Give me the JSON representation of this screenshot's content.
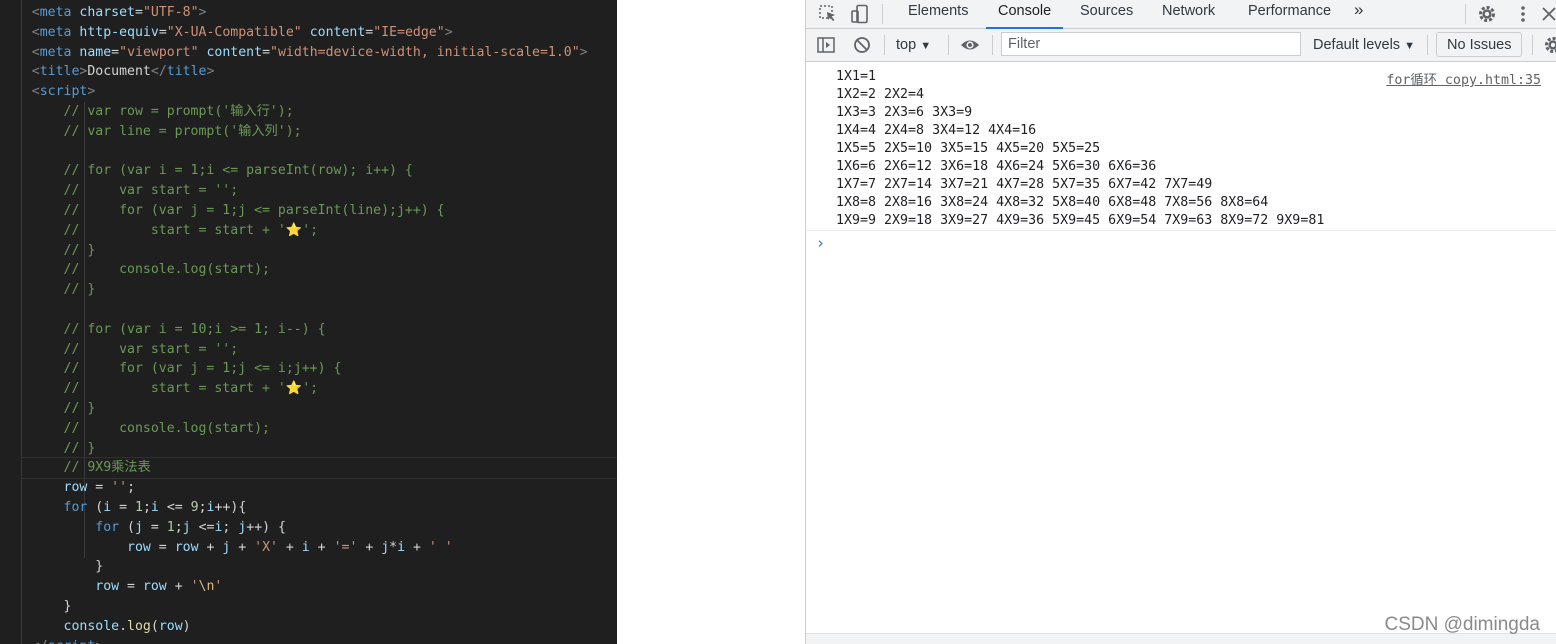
{
  "editor": {
    "lines": [
      [
        {
          "c": "tk-punc",
          "t": "    <"
        },
        {
          "c": "tk-tag",
          "t": "meta "
        },
        {
          "c": "tk-attr",
          "t": "charset"
        },
        {
          "c": "tk-text",
          "t": "="
        },
        {
          "c": "tk-str",
          "t": "\"UTF-8\""
        },
        {
          "c": "tk-punc",
          "t": ">"
        }
      ],
      [
        {
          "c": "tk-punc",
          "t": "    <"
        },
        {
          "c": "tk-tag",
          "t": "meta "
        },
        {
          "c": "tk-attr",
          "t": "http-equiv"
        },
        {
          "c": "tk-text",
          "t": "="
        },
        {
          "c": "tk-str",
          "t": "\"X-UA-Compatible\""
        },
        {
          "c": "tk-text",
          "t": " "
        },
        {
          "c": "tk-attr",
          "t": "content"
        },
        {
          "c": "tk-text",
          "t": "="
        },
        {
          "c": "tk-str",
          "t": "\"IE=edge\""
        },
        {
          "c": "tk-punc",
          "t": ">"
        }
      ],
      [
        {
          "c": "tk-punc",
          "t": "    <"
        },
        {
          "c": "tk-tag",
          "t": "meta "
        },
        {
          "c": "tk-attr",
          "t": "name"
        },
        {
          "c": "tk-text",
          "t": "="
        },
        {
          "c": "tk-str",
          "t": "\"viewport\""
        },
        {
          "c": "tk-text",
          "t": " "
        },
        {
          "c": "tk-attr",
          "t": "content"
        },
        {
          "c": "tk-text",
          "t": "="
        },
        {
          "c": "tk-str",
          "t": "\"width=device-width, initial-scale=1.0\""
        },
        {
          "c": "tk-punc",
          "t": ">"
        }
      ],
      [
        {
          "c": "tk-punc",
          "t": "    <"
        },
        {
          "c": "tk-tag",
          "t": "title"
        },
        {
          "c": "tk-punc",
          "t": ">"
        },
        {
          "c": "tk-text",
          "t": "Document"
        },
        {
          "c": "tk-punc",
          "t": "</"
        },
        {
          "c": "tk-tag",
          "t": "title"
        },
        {
          "c": "tk-punc",
          "t": ">"
        }
      ],
      [
        {
          "c": "tk-punc",
          "t": "    <"
        },
        {
          "c": "tk-tag",
          "t": "script"
        },
        {
          "c": "tk-punc",
          "t": ">"
        }
      ],
      [
        {
          "c": "tk-com",
          "t": "        // var row = prompt('输入行');"
        }
      ],
      [
        {
          "c": "tk-com",
          "t": "        // var line = prompt('输入列');"
        }
      ],
      [
        {
          "c": "tk-text",
          "t": ""
        }
      ],
      [
        {
          "c": "tk-com",
          "t": "        // for (var i = 1;i <= parseInt(row); i++) {"
        }
      ],
      [
        {
          "c": "tk-com",
          "t": "        //     var start = '';"
        }
      ],
      [
        {
          "c": "tk-com",
          "t": "        //     for (var j = 1;j <= parseInt(line);j++) {"
        }
      ],
      [
        {
          "c": "tk-com",
          "t": "        //         start = start + '⭐';"
        }
      ],
      [
        {
          "c": "tk-com",
          "t": "        // }"
        }
      ],
      [
        {
          "c": "tk-com",
          "t": "        //     console.log(start);"
        }
      ],
      [
        {
          "c": "tk-com",
          "t": "        // }"
        }
      ],
      [
        {
          "c": "tk-text",
          "t": ""
        }
      ],
      [
        {
          "c": "tk-com",
          "t": "        // for (var i = 10;i >= 1; i--) {"
        }
      ],
      [
        {
          "c": "tk-com",
          "t": "        //     var start = '';"
        }
      ],
      [
        {
          "c": "tk-com",
          "t": "        //     for (var j = 1;j <= i;j++) {"
        }
      ],
      [
        {
          "c": "tk-com",
          "t": "        //         start = start + '⭐';"
        }
      ],
      [
        {
          "c": "tk-com",
          "t": "        // }"
        }
      ],
      [
        {
          "c": "tk-com",
          "t": "        //     console.log(start);"
        }
      ],
      [
        {
          "c": "tk-com",
          "t": "        // }"
        }
      ],
      [
        {
          "c": "tk-com",
          "t": "        // 9X9乘法表"
        }
      ],
      [
        {
          "c": "tk-var",
          "t": "        row"
        },
        {
          "c": "tk-op",
          "t": " = "
        },
        {
          "c": "tk-str",
          "t": "''"
        },
        {
          "c": "tk-op",
          "t": ";"
        }
      ],
      [
        {
          "c": "tk-kw",
          "t": "        for"
        },
        {
          "c": "tk-op",
          "t": " ("
        },
        {
          "c": "tk-var",
          "t": "i"
        },
        {
          "c": "tk-op",
          "t": " = "
        },
        {
          "c": "tk-num",
          "t": "1"
        },
        {
          "c": "tk-op",
          "t": ";"
        },
        {
          "c": "tk-var",
          "t": "i"
        },
        {
          "c": "tk-op",
          "t": " <= "
        },
        {
          "c": "tk-num",
          "t": "9"
        },
        {
          "c": "tk-op",
          "t": ";"
        },
        {
          "c": "tk-var",
          "t": "i"
        },
        {
          "c": "tk-op",
          "t": "++){"
        }
      ],
      [
        {
          "c": "tk-kw",
          "t": "            for"
        },
        {
          "c": "tk-op",
          "t": " ("
        },
        {
          "c": "tk-var",
          "t": "j"
        },
        {
          "c": "tk-op",
          "t": " = "
        },
        {
          "c": "tk-num",
          "t": "1"
        },
        {
          "c": "tk-op",
          "t": ";"
        },
        {
          "c": "tk-var",
          "t": "j"
        },
        {
          "c": "tk-op",
          "t": " <="
        },
        {
          "c": "tk-var",
          "t": "i"
        },
        {
          "c": "tk-op",
          "t": "; "
        },
        {
          "c": "tk-var",
          "t": "j"
        },
        {
          "c": "tk-op",
          "t": "++) {"
        }
      ],
      [
        {
          "c": "tk-var",
          "t": "                row"
        },
        {
          "c": "tk-op",
          "t": " = "
        },
        {
          "c": "tk-var",
          "t": "row"
        },
        {
          "c": "tk-op",
          "t": " + "
        },
        {
          "c": "tk-var",
          "t": "j"
        },
        {
          "c": "tk-op",
          "t": " + "
        },
        {
          "c": "tk-str",
          "t": "'X'"
        },
        {
          "c": "tk-op",
          "t": " + "
        },
        {
          "c": "tk-var",
          "t": "i"
        },
        {
          "c": "tk-op",
          "t": " + "
        },
        {
          "c": "tk-str",
          "t": "'='"
        },
        {
          "c": "tk-op",
          "t": " + "
        },
        {
          "c": "tk-var",
          "t": "j"
        },
        {
          "c": "tk-op",
          "t": "*"
        },
        {
          "c": "tk-var",
          "t": "i"
        },
        {
          "c": "tk-op",
          "t": " + "
        },
        {
          "c": "tk-str",
          "t": "' '"
        }
      ],
      [
        {
          "c": "tk-op",
          "t": "            }"
        }
      ],
      [
        {
          "c": "tk-var",
          "t": "            row"
        },
        {
          "c": "tk-op",
          "t": " = "
        },
        {
          "c": "tk-var",
          "t": "row"
        },
        {
          "c": "tk-op",
          "t": " + "
        },
        {
          "c": "tk-str",
          "t": "'"
        },
        {
          "c": "tk-esc",
          "t": "\\n"
        },
        {
          "c": "tk-str",
          "t": "'"
        }
      ],
      [
        {
          "c": "tk-op",
          "t": "        }"
        }
      ],
      [
        {
          "c": "tk-var",
          "t": "        console"
        },
        {
          "c": "tk-op",
          "t": "."
        },
        {
          "c": "tk-fn",
          "t": "log"
        },
        {
          "c": "tk-op",
          "t": "("
        },
        {
          "c": "tk-var",
          "t": "row"
        },
        {
          "c": "tk-op",
          "t": ")"
        }
      ],
      [
        {
          "c": "tk-punc",
          "t": "    </"
        },
        {
          "c": "tk-tag",
          "t": "script"
        },
        {
          "c": "tk-punc",
          "t": ">"
        }
      ]
    ]
  },
  "devtools": {
    "tabs": [
      {
        "id": "elements",
        "label": "Elements",
        "active": false
      },
      {
        "id": "console",
        "label": "Console",
        "active": true
      },
      {
        "id": "sources",
        "label": "Sources",
        "active": false
      },
      {
        "id": "network",
        "label": "Network",
        "active": false
      },
      {
        "id": "performance",
        "label": "Performance",
        "active": false
      }
    ],
    "more_tabs_label": "»",
    "toolbar": {
      "context": "top",
      "filter_placeholder": "Filter",
      "levels": "Default levels",
      "issues": "No Issues"
    },
    "console": {
      "log_lines": [
        "1X1=1",
        "1X2=2 2X2=4",
        "1X3=3 2X3=6 3X3=9",
        "1X4=4 2X4=8 3X4=12 4X4=16",
        "1X5=5 2X5=10 3X5=15 4X5=20 5X5=25",
        "1X6=6 2X6=12 3X6=18 4X6=24 5X6=30 6X6=36",
        "1X7=7 2X7=14 3X7=21 4X7=28 5X7=35 6X7=42 7X7=49",
        "1X8=8 2X8=16 3X8=24 4X8=32 5X8=40 6X8=48 7X8=56 8X8=64",
        "1X9=9 2X9=18 3X9=27 4X9=36 5X9=45 6X9=54 7X9=63 8X9=72 9X9=81"
      ],
      "source_link": "for循环 copy.html:35",
      "prompt_symbol": "›"
    },
    "colors": {
      "accent": "#1a73e8",
      "panel_bg": "#f1f3f4",
      "editor_bg": "#1f1f1f"
    }
  },
  "watermark": "CSDN @dimingda"
}
